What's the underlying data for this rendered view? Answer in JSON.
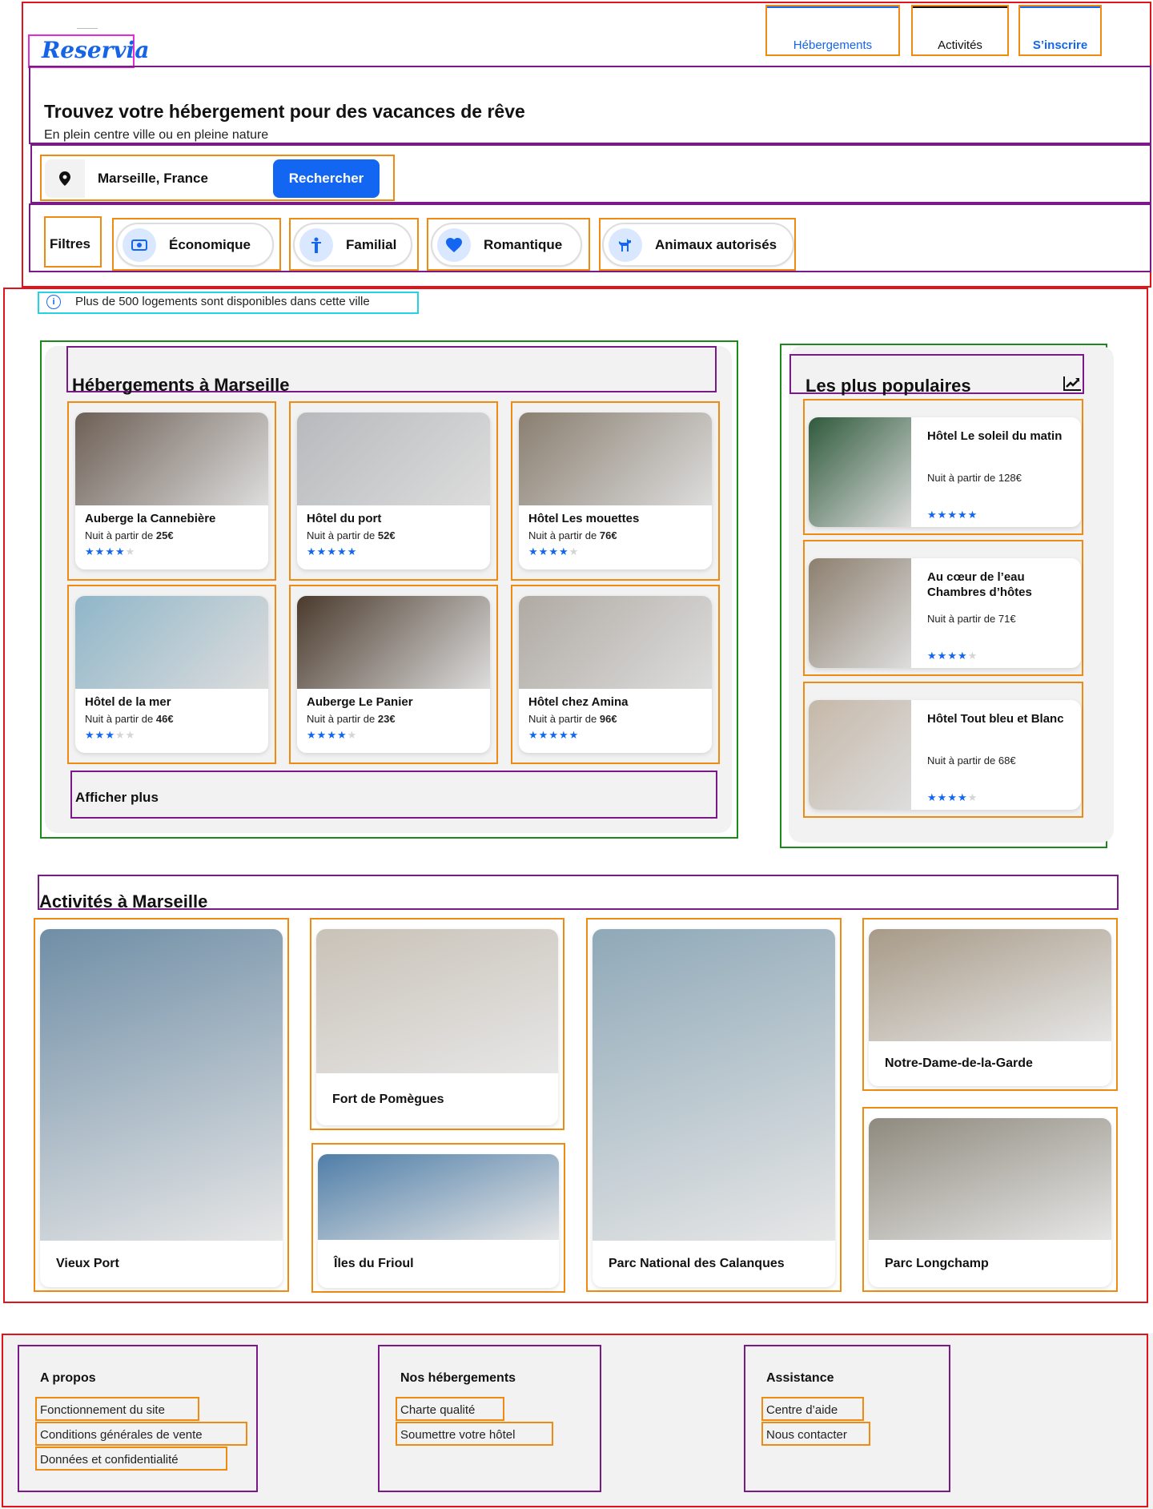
{
  "header": {
    "logo": "Reservia",
    "nav": [
      "Hébergements",
      "Activités",
      "S’inscrire"
    ]
  },
  "hero": {
    "title": "Trouvez votre hébergement pour des vacances de rêve",
    "subtitle": "En plein centre ville ou en pleine nature"
  },
  "search": {
    "value": "Marseille, France",
    "button": "Rechercher"
  },
  "filters": {
    "label": "Filtres",
    "items": [
      {
        "label": "Économique",
        "icon": "money-icon"
      },
      {
        "label": "Familial",
        "icon": "person-icon"
      },
      {
        "label": "Romantique",
        "icon": "heart-icon"
      },
      {
        "label": "Animaux autorisés",
        "icon": "dog-icon"
      }
    ]
  },
  "info": {
    "text": "Plus de 500 logements sont disponibles dans cette ville"
  },
  "lodgings": {
    "title": "Hébergements à Marseille",
    "show_more": "Afficher plus",
    "items": [
      {
        "name": "Auberge la Cannebière",
        "price_prefix": "Nuit à partir de ",
        "price": "25€",
        "rating": 4,
        "image": "bunk-bed-room-photo"
      },
      {
        "name": "Hôtel du port",
        "price_prefix": "Nuit à partir de ",
        "price": "52€",
        "rating": 5,
        "image": "white-room-photo"
      },
      {
        "name": "Hôtel Les mouettes",
        "price_prefix": "Nuit à partir de ",
        "price": "76€",
        "rating": 4,
        "image": "modern-room-photo"
      },
      {
        "name": "Hôtel de la mer",
        "price_prefix": "Nuit à partir de ",
        "price": "46€",
        "rating": 3,
        "image": "sea-painting-room-photo"
      },
      {
        "name": "Auberge Le Panier",
        "price_prefix": "Nuit à partir de ",
        "price": "23€",
        "rating": 4,
        "image": "wooden-bunks-photo"
      },
      {
        "name": "Hôtel chez Amina",
        "price_prefix": "Nuit à partir de ",
        "price": "96€",
        "rating": 5,
        "image": "bright-room-photo"
      }
    ]
  },
  "popular": {
    "title": "Les plus populaires",
    "icon": "trending-icon",
    "items": [
      {
        "name": "Hôtel Le soleil du matin",
        "price": "Nuit à partir de 128€",
        "rating": 5,
        "image": "green-room-photo"
      },
      {
        "name": "Au cœur de l’eau Chambres d’hôtes",
        "price": "Nuit à partir de 71€",
        "rating": 4,
        "image": "classic-room-photo"
      },
      {
        "name": "Hôtel Tout bleu et Blanc",
        "price": "Nuit à partir de 68€",
        "rating": 4,
        "image": "twin-room-photo"
      }
    ]
  },
  "activities": {
    "title": "Activités à Marseille",
    "items": [
      {
        "name": "Vieux Port",
        "image": "harbor-boats-photo"
      },
      {
        "name": "Fort de Pomègues",
        "image": "fort-rocks-photo"
      },
      {
        "name": "Îles du Frioul",
        "image": "island-sea-photo"
      },
      {
        "name": "Parc National des Calanques",
        "image": "calanques-cliffs-photo"
      },
      {
        "name": "Notre-Dame-de-la-Garde",
        "image": "basilica-hill-photo"
      },
      {
        "name": "Parc Longchamp",
        "image": "palace-colonnade-photo"
      }
    ]
  },
  "footer": {
    "columns": [
      {
        "title": "A propos",
        "links": [
          "Fonctionnement du site",
          "Conditions générales de vente",
          "Données et confidentialité"
        ]
      },
      {
        "title": "Nos hébergements",
        "links": [
          "Charte qualité",
          "Soumettre votre hôtel"
        ]
      },
      {
        "title": "Assistance",
        "links": [
          "Centre d’aide",
          "Nous contacter"
        ]
      }
    ]
  },
  "colors": {
    "accent": "#1266f1",
    "panel": "#f2f2f2",
    "wire_red": "#e1141b",
    "wire_purple": "#7a1a88",
    "wire_orange": "#f08a10",
    "wire_green": "#1a8a1a"
  }
}
